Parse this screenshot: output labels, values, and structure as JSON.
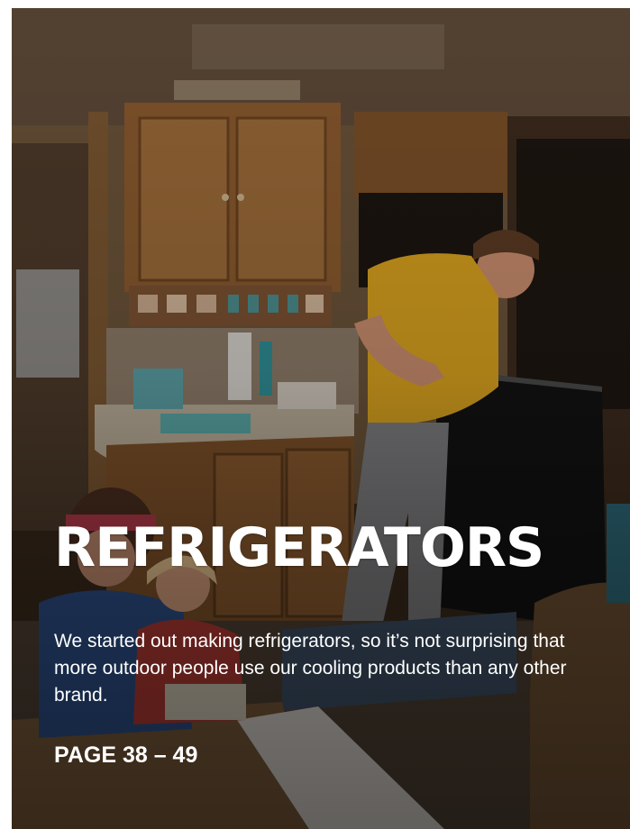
{
  "section": {
    "title": "REFRIGERATORS",
    "description": "We started out making refrigerators, so it’s not surprising that more outdoor people use our cooling products than any other brand.",
    "page_range": "PAGE 38 – 49"
  },
  "colors": {
    "text": "#ffffff",
    "cabinet_wood": "#8a5a2e",
    "shirt": "#d9a21f"
  }
}
